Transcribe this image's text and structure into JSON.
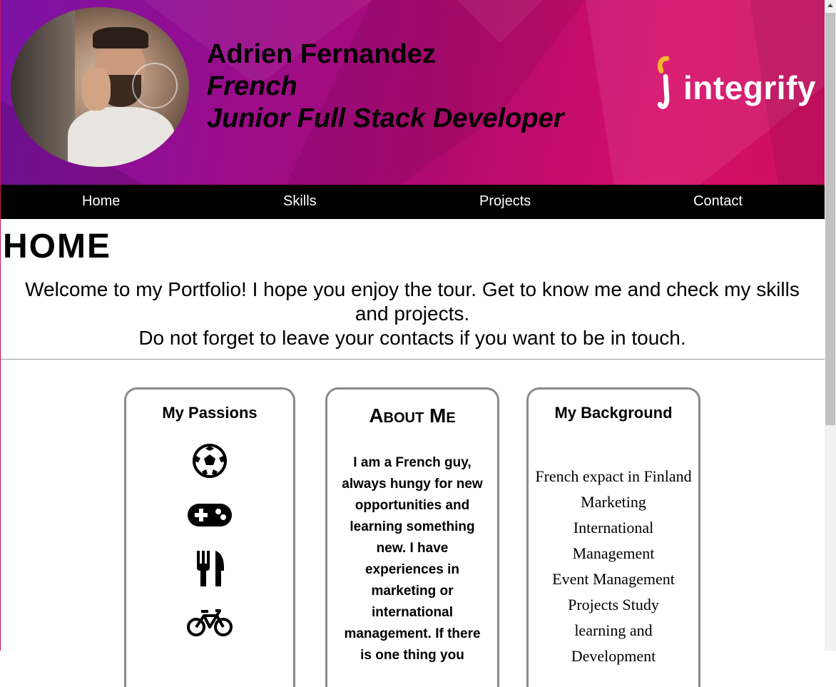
{
  "header": {
    "name": "Adrien Fernandez",
    "nationality": "French",
    "role": "Junior Full Stack Developer",
    "logo_text": "integrify"
  },
  "nav": {
    "items": [
      {
        "label": "Home"
      },
      {
        "label": "Skills"
      },
      {
        "label": "Projects"
      },
      {
        "label": "Contact"
      }
    ]
  },
  "home": {
    "title": "HOME",
    "welcome_line1": "Welcome to my Portfolio! I hope you enjoy the tour. Get to know me and check my skills and projects.",
    "welcome_line2": "Do not forget to leave your contacts if you want to be in touch."
  },
  "cards": {
    "passions": {
      "title": "My Passions",
      "icons": [
        "soccer-ball-icon",
        "gamepad-icon",
        "cutlery-icon",
        "bicycle-icon"
      ]
    },
    "about": {
      "title": "About Me",
      "text": "I am a French guy, always hungy for new opportunities and learning something new. I have experiences in marketing or international management. If there is one thing you"
    },
    "background": {
      "title": "My Background",
      "items": [
        "French expact in Finland",
        "Marketing",
        "International Management",
        "Event Management",
        "Projects Study",
        "learning and Development"
      ]
    }
  },
  "colors": {
    "banner_start": "#7b13a6",
    "banner_end": "#d60e6a",
    "nav_bg": "#000000",
    "logo_yellow": "#f5b52e"
  }
}
